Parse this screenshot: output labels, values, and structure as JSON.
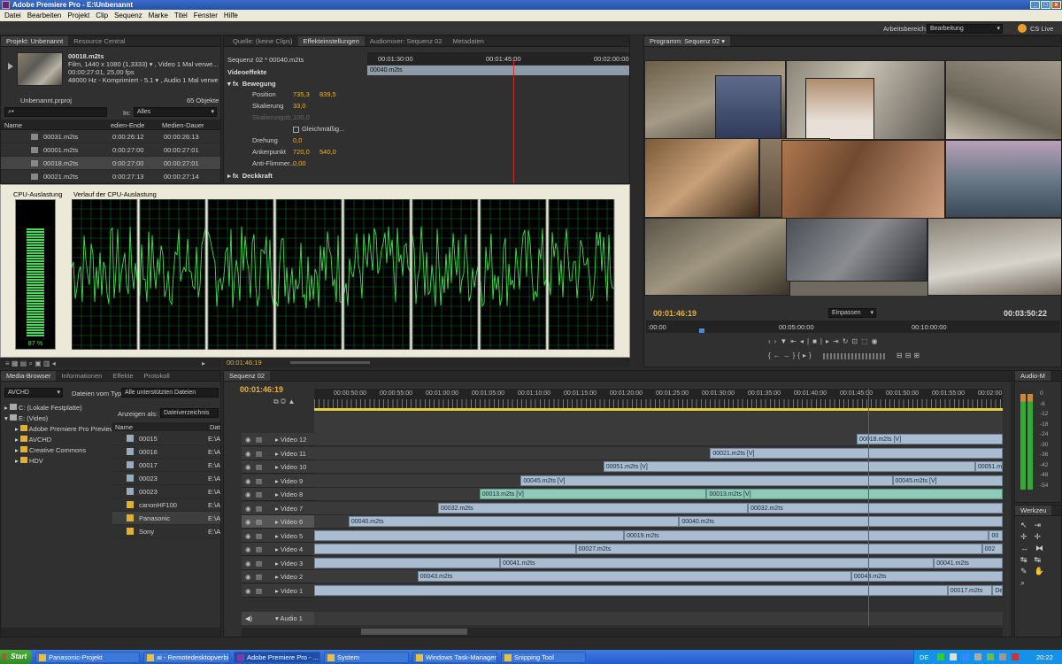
{
  "window": {
    "title": "Adobe Premiere Pro - E:\\Unbenannt"
  },
  "menu": [
    "Datei",
    "Bearbeiten",
    "Projekt",
    "Clip",
    "Sequenz",
    "Marke",
    "Titel",
    "Fenster",
    "Hilfe"
  ],
  "workspace": {
    "label": "Arbeitsbereich:",
    "value": "Bearbeitung",
    "cslive": "CS Live"
  },
  "project_panel": {
    "tabs": [
      "Projekt: Unbenannt",
      "Resource Central"
    ],
    "clip_name": "00018.m2ts",
    "clip_info": [
      "Film, 1440 x 1080 (1,3333)  ▾ , Video 1 Mal verwe...",
      "00:00:27:01, 25,00 fps",
      "48000 Hz - Komprimiert - 5.1  ▾ , Audio 1 Mal verwe..."
    ],
    "project_file": "Unbenannt.prproj",
    "count": "65 Objekte",
    "in_label": "In:",
    "in_value": "Alles",
    "columns": [
      "Name",
      "edien-Ende",
      "Medien-Dauer"
    ],
    "rows": [
      {
        "name": "00031.m2ts",
        "end": "0:00:26:12",
        "dur": "00:00:26:13"
      },
      {
        "name": "00001.m2ts",
        "end": "0:00:27:00",
        "dur": "00:00:27:01"
      },
      {
        "name": "00018.m2ts",
        "end": "0:00:27:00",
        "dur": "00:00:27:01"
      },
      {
        "name": "00021.m2ts",
        "end": "0:00:27:13",
        "dur": "00:00:27:14"
      }
    ]
  },
  "source_panel": {
    "tabs": [
      "Quelle: (keine Clips)",
      "Effekteinstellungen",
      "Audiomixer: Sequenz 02",
      "Metadaten"
    ],
    "seq_label": "Sequenz 02 * 00040.m2ts",
    "ruler": [
      "00:01:30:00",
      "00:01:45:00",
      "00:02:00:00"
    ],
    "clip_label": "00040.m2ts",
    "section": "Videoeffekte",
    "motion": "Bewegung",
    "props": [
      {
        "name": "Position",
        "v1": "735,3",
        "v2": "839,5"
      },
      {
        "name": "Skalierung",
        "v1": "33,0",
        "v2": ""
      },
      {
        "name": "Skalierungsb...",
        "v1": "100,0",
        "v2": ""
      },
      {
        "name": "Gleichmäßig...",
        "v1": "",
        "v2": ""
      },
      {
        "name": "Drehung",
        "v1": "0,0",
        "v2": ""
      },
      {
        "name": "Ankerpunkt",
        "v1": "720,0",
        "v2": "540,0"
      },
      {
        "name": "Anti-Flimmer...",
        "v1": "0,00",
        "v2": ""
      }
    ],
    "opacity": "Deckkraft",
    "timecode": "00:01:46:19"
  },
  "cpu": {
    "title_left": "CPU-Auslastung",
    "title_right": "Verlauf der CPU-Auslastung",
    "percent": "87 %",
    "load_fraction": 0.87,
    "cores": 8
  },
  "program": {
    "tab": "Programm: Sequenz 02",
    "timecode": "00:01:46:19",
    "fit": "Einpassen",
    "duration": "00:03:50:22",
    "ruler": [
      ":00:00",
      "00:05:00:00",
      "00:10:00:00"
    ]
  },
  "media_browser": {
    "tabs": [
      "Media-Browser",
      "Informationen",
      "Effekte",
      "Protokoll"
    ],
    "drive_select": "AVCHD",
    "filetype_label": "Dateien vom Typ:",
    "filetype_value": "Alle unterstützten Dateien",
    "show_label": "Anzeigen als:",
    "show_value": "Dateiverzeichnis",
    "tree": [
      {
        "label": "C: (Lokale Festplatte)",
        "indent": 0
      },
      {
        "label": "E: (Video)",
        "indent": 0
      },
      {
        "label": "Adobe Premiere Pro Preview",
        "indent": 1
      },
      {
        "label": "AVCHD",
        "indent": 1
      },
      {
        "label": "Creative Commons",
        "indent": 1
      },
      {
        "label": "HDV",
        "indent": 1
      }
    ],
    "columns": [
      "Name",
      "Dat"
    ],
    "files": [
      {
        "name": "00015",
        "path": "E:\\A"
      },
      {
        "name": "00016",
        "path": "E:\\A"
      },
      {
        "name": "00017",
        "path": "E:\\A"
      },
      {
        "name": "00023",
        "path": "E:\\A"
      },
      {
        "name": "00023",
        "path": "E:\\A"
      },
      {
        "name": "canonHF100",
        "path": "E:\\A"
      },
      {
        "name": "Panasonic",
        "path": "E:\\A"
      },
      {
        "name": "Sony",
        "path": "E:\\A"
      }
    ]
  },
  "timeline": {
    "tab": "Sequenz 02",
    "timecode": "00:01:46:19",
    "ruler": [
      "00:00:50:00",
      "00:00:55:00",
      "00:01:00:00",
      "00:01:05:00",
      "00:01:10:00",
      "00:01:15:00",
      "00:01:20:00",
      "00:01:25:00",
      "00:01:30:00",
      "00:01:35:00",
      "00:01:40:00",
      "00:01:45:00",
      "00:01:50:00",
      "00:01:55:00",
      "00:02:00"
    ],
    "tracks": [
      {
        "name": "Video 12",
        "clips": [
          {
            "label": "00018.m2ts [V]",
            "start": 0.788,
            "end": 1.0,
            "green": false
          }
        ]
      },
      {
        "name": "Video 11",
        "clips": [
          {
            "label": "00021.m2ts [V]",
            "start": 0.575,
            "end": 1.0,
            "green": false
          }
        ]
      },
      {
        "name": "Video 10",
        "clips": [
          {
            "label": "00051.m2ts [V]",
            "start": 0.42,
            "end": 0.96,
            "green": false
          },
          {
            "label": "00051.m",
            "start": 0.96,
            "end": 1.0,
            "green": false
          }
        ]
      },
      {
        "name": "Video 9",
        "clips": [
          {
            "label": "00045.m2ts [V]",
            "start": 0.3,
            "end": 0.84,
            "green": false
          },
          {
            "label": "00045.m2ts [V]",
            "start": 0.84,
            "end": 1.0,
            "green": false
          }
        ]
      },
      {
        "name": "Video 8",
        "clips": [
          {
            "label": "00013.m2ts [V]",
            "start": 0.24,
            "end": 0.57,
            "green": true
          },
          {
            "label": "00013.m2ts [V]",
            "start": 0.57,
            "end": 1.0,
            "green": true
          }
        ]
      },
      {
        "name": "Video 7",
        "clips": [
          {
            "label": "00032.m2ts",
            "start": 0.18,
            "end": 0.63,
            "green": false
          },
          {
            "label": "00032.m2ts",
            "start": 0.63,
            "end": 1.0,
            "green": false
          }
        ]
      },
      {
        "name": "Video 6",
        "clips": [
          {
            "label": "00040.m2ts",
            "start": 0.05,
            "end": 0.53,
            "green": false
          },
          {
            "label": "00040.m2ts",
            "start": 0.53,
            "end": 1.0,
            "green": false
          }
        ]
      },
      {
        "name": "Video 5",
        "clips": [
          {
            "label": "",
            "start": 0.0,
            "end": 0.45,
            "green": false
          },
          {
            "label": "00019.m2ts",
            "start": 0.45,
            "end": 0.98,
            "green": false
          },
          {
            "label": "00",
            "start": 0.98,
            "end": 1.0,
            "green": false
          }
        ]
      },
      {
        "name": "Video 4",
        "clips": [
          {
            "label": "",
            "start": 0.0,
            "end": 0.38,
            "green": false
          },
          {
            "label": "00027.m2ts",
            "start": 0.38,
            "end": 0.97,
            "green": false
          },
          {
            "label": "002",
            "start": 0.97,
            "end": 1.0,
            "green": false
          }
        ]
      },
      {
        "name": "Video 3",
        "clips": [
          {
            "label": "",
            "start": 0.0,
            "end": 0.27,
            "green": false
          },
          {
            "label": "00041.m2ts",
            "start": 0.27,
            "end": 0.9,
            "green": false
          },
          {
            "label": "00041.m2ts",
            "start": 0.9,
            "end": 1.0,
            "green": false
          }
        ]
      },
      {
        "name": "Video 2",
        "clips": [
          {
            "label": "00043.m2ts",
            "start": 0.15,
            "end": 0.78,
            "green": false
          },
          {
            "label": "00043.m2ts",
            "start": 0.78,
            "end": 1.0,
            "green": false
          }
        ]
      },
      {
        "name": "Video 1",
        "clips": [
          {
            "label": "",
            "start": 0.0,
            "end": 0.92,
            "green": false
          },
          {
            "label": "00017.m2ts",
            "start": 0.92,
            "end": 0.985,
            "green": false
          },
          {
            "label": "Deckk",
            "start": 0.985,
            "end": 1.0,
            "green": false
          }
        ]
      }
    ],
    "audio_track": "Audio 1",
    "playhead": 0.805
  },
  "audio_meter": {
    "title": "Audio-M",
    "scale": [
      "0",
      "-6",
      "-12",
      "-18",
      "-24",
      "-30",
      "-36",
      "-42",
      "-48",
      "-54"
    ]
  },
  "tools": {
    "title": "Werkzeu"
  },
  "taskbar": {
    "start": "Start",
    "items": [
      {
        "label": "Panasonic-Projekt",
        "active": false
      },
      {
        "label": "ai - Remotedesktopverbi...",
        "active": false
      },
      {
        "label": "Adobe Premiere Pro - ...",
        "active": true
      },
      {
        "label": "System",
        "active": false
      },
      {
        "label": "Windows Task-Manager",
        "active": false
      },
      {
        "label": "Snipping Tool",
        "active": false
      }
    ],
    "lang": "DE",
    "clock": "20:22"
  }
}
